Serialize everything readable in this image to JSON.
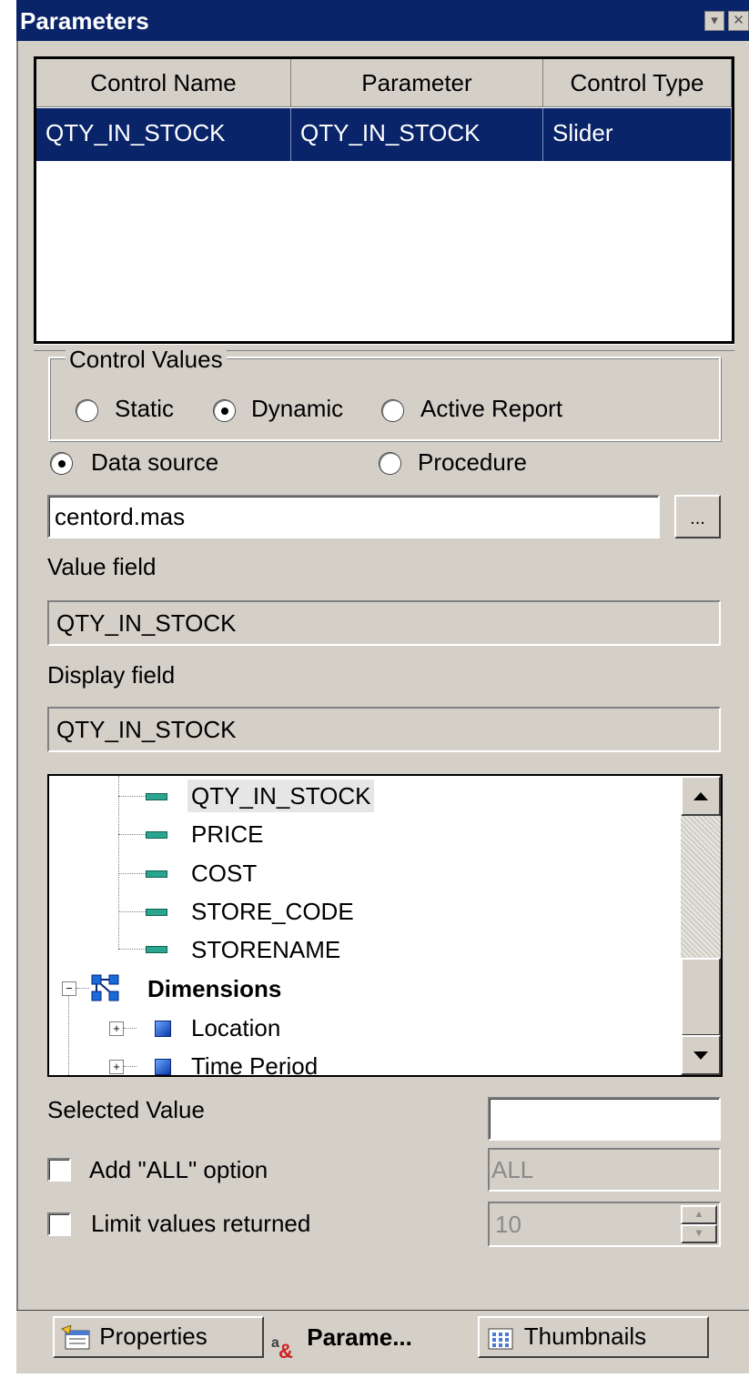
{
  "window": {
    "title": "Parameters"
  },
  "grid": {
    "columns": [
      "Control Name",
      "Parameter",
      "Control Type"
    ],
    "rows": [
      [
        "QTY_IN_STOCK",
        "QTY_IN_STOCK",
        "Slider"
      ]
    ]
  },
  "control_values": {
    "legend": "Control Values",
    "options": [
      "Static",
      "Dynamic",
      "Active Report"
    ],
    "selected": "Dynamic"
  },
  "source": {
    "options": [
      "Data source",
      "Procedure"
    ],
    "selected": "Data source",
    "value": "centord.mas",
    "browse_label": "..."
  },
  "value_field": {
    "label": "Value field",
    "value": "QTY_IN_STOCK"
  },
  "display_field": {
    "label": "Display field",
    "value": "QTY_IN_STOCK"
  },
  "tree": {
    "fields": [
      "QTY_IN_STOCK",
      "PRICE",
      "COST",
      "STORE_CODE",
      "STORENAME"
    ],
    "selected": "QTY_IN_STOCK",
    "group": "Dimensions",
    "children": [
      "Location",
      "Time Period"
    ]
  },
  "selected_value": {
    "label": "Selected Value",
    "value": ""
  },
  "all_option": {
    "label": "Add \"ALL\" option",
    "checked": false,
    "value": "ALL"
  },
  "limit": {
    "label": "Limit values returned",
    "checked": false,
    "value": "10"
  },
  "tabs": [
    {
      "label": "Properties",
      "icon": "properties-icon",
      "active": false
    },
    {
      "label": "Parame...",
      "icon": "parameters-icon",
      "active": true
    },
    {
      "label": "Thumbnails",
      "icon": "thumbnails-icon",
      "active": false
    }
  ],
  "colors": {
    "selection": "#0a246a",
    "face": "#d4d0c8"
  }
}
